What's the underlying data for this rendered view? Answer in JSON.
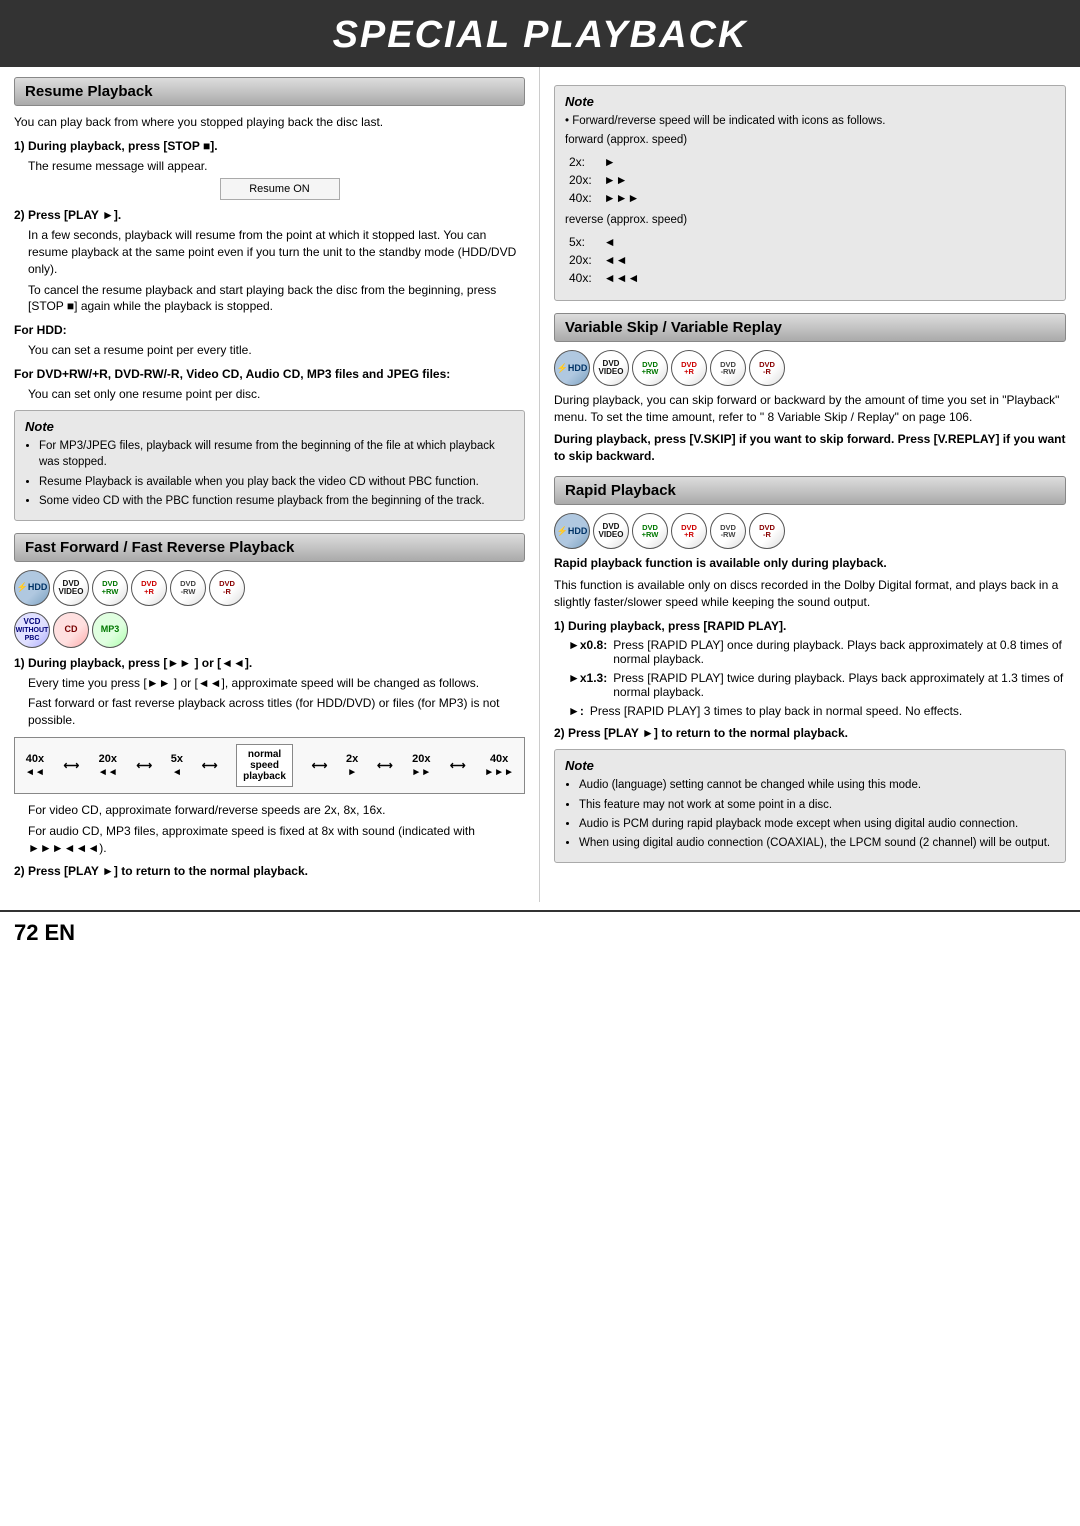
{
  "header": {
    "title": "SPECIAL PLAYBACK"
  },
  "footer": {
    "page_number": "72",
    "en": "EN"
  },
  "left_col": {
    "resume_section": {
      "title": "Resume Playback",
      "intro": "You can play back from where you stopped playing back the disc last.",
      "step1_header": "1) During playback, press [STOP ■].",
      "step1_text": "The resume message will appear.",
      "resume_box": "Resume ON",
      "step2_header": "2) Press [PLAY ►].",
      "step2_text": "In a few seconds, playback will resume from the point at which it stopped last. You can resume playback at the same point even if you turn the unit to the standby mode (HDD/DVD only).",
      "cancel_text": "To cancel the resume playback and start playing back the disc from the beginning, press [STOP ■] again while the playback is stopped.",
      "for_hdd_header": "For HDD:",
      "for_hdd_text": "You can set a resume point per every title.",
      "for_dvd_header": "For DVD+RW/+R, DVD-RW/-R, Video CD, Audio CD, MP3 files and JPEG files:",
      "for_dvd_text": "You can set only one resume point per disc.",
      "note_title": "Note",
      "note_items": [
        "For MP3/JPEG files, playback will resume from the beginning of the file at which playback was stopped.",
        "Resume Playback is available when you play back the video CD without PBC function.",
        "Some video CD with the PBC function resume playback from the beginning of the track."
      ]
    },
    "fast_forward_section": {
      "title": "Fast Forward / Fast Reverse Playback",
      "disc_icons": [
        "HDD",
        "DVD Video",
        "DVD +RW",
        "DVD +R",
        "DVD -RW",
        "DVD -R",
        "VCD",
        "CD",
        "MP3"
      ],
      "step1_header": "1) During playback, press [►► ] or [◄◄].",
      "step1_text1": "Every time you press [►► ] or [◄◄], approximate speed will be changed as follows.",
      "step1_text2": "Fast forward or fast reverse playback across titles (for HDD/DVD) or files (for MP3) is not possible.",
      "speed_sequence": "40x ←→ 20x ←→ 5x ←→ normal speed playback ←→ 2x ←→ 20x ←→ 40x",
      "vcd_text": "For video CD, approximate forward/reverse speeds are 2x, 8x, 16x.",
      "mp3_text": "For audio CD, MP3 files, approximate speed is fixed at 8x with sound (indicated with ►►►◄◄◄).",
      "step2_header": "2) Press [PLAY ►] to return to the normal playback."
    }
  },
  "right_col": {
    "note_section": {
      "title": "Note",
      "intro": "Forward/reverse speed will be indicated with icons as follows.",
      "forward_label": "forward (approx. speed)",
      "speeds_forward": [
        {
          "speed": "2x:",
          "symbol": "►"
        },
        {
          "speed": "20x:",
          "symbol": "►►"
        },
        {
          "speed": "40x:",
          "symbol": "►►►"
        }
      ],
      "reverse_label": "reverse (approx. speed)",
      "speeds_reverse": [
        {
          "speed": "5x:",
          "symbol": "◄"
        },
        {
          "speed": "20x:",
          "symbol": "◄◄"
        },
        {
          "speed": "40x:",
          "symbol": "◄◄◄"
        }
      ]
    },
    "variable_skip_section": {
      "title": "Variable Skip / Variable Replay",
      "disc_icons": [
        "HDD",
        "DVD Video",
        "DVD +RW",
        "DVD +R",
        "DVD -RW",
        "DVD -R"
      ],
      "text1": "During playback, you can skip forward or backward by the amount of time you set in \"Playback\" menu. To set the time amount, refer to \" 8 Variable Skip / Replay\" on page 106.",
      "instruction": "During playback, press [V.SKIP] if you want to skip forward. Press [V.REPLAY] if you want to skip backward."
    },
    "rapid_playback_section": {
      "title": "Rapid Playback",
      "disc_icons": [
        "HDD",
        "DVD Video",
        "DVD +RW",
        "DVD +R",
        "DVD -RW",
        "DVD -R"
      ],
      "bold_text": "Rapid playback function is available only during playback.",
      "text1": "This function is available only on discs recorded in the Dolby Digital format, and plays back in a slightly faster/slower speed while keeping the sound output.",
      "step1_header": "1) During playback, press [RAPID PLAY].",
      "x08_header": "►x0.8:",
      "x08_text": "Press [RAPID PLAY] once during playback. Plays back approximately at 0.8 times of normal playback.",
      "x13_header": "►x1.3:",
      "x13_text": "Press [RAPID PLAY] twice during playback. Plays back approximately at 1.3 times of normal playback.",
      "play_header": "►:",
      "play_text": "Press [RAPID PLAY] 3 times to play back in normal speed. No effects.",
      "step2_header": "2) Press [PLAY ►] to return to the normal playback.",
      "note_title": "Note",
      "note_items": [
        "Audio (language) setting cannot be changed while using this mode.",
        "This feature may not work at some point in a disc.",
        "Audio is PCM during rapid playback mode except when using digital audio connection.",
        "When using digital audio connection (COAXIAL), the LPCM sound (2 channel) will be output."
      ]
    }
  }
}
